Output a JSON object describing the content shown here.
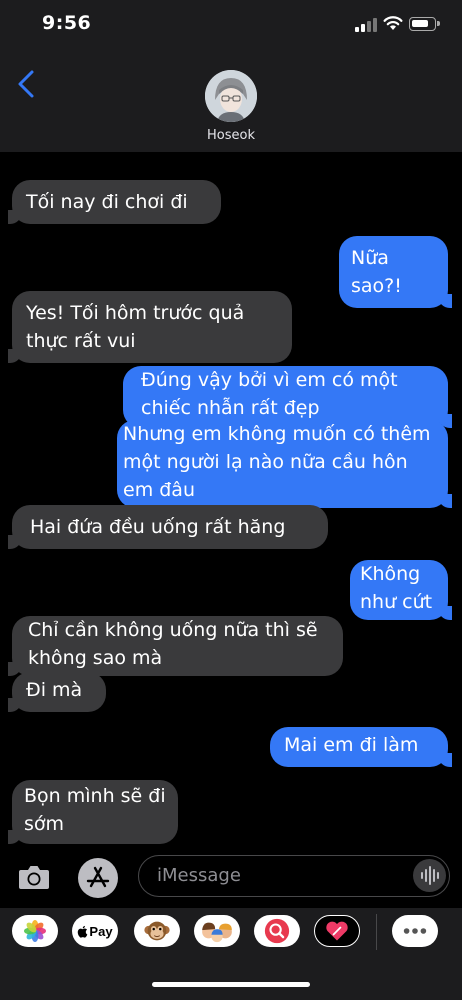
{
  "status": {
    "time": "9:56"
  },
  "header": {
    "contact_name": "Hoseok",
    "back_icon": "chevron-left-icon"
  },
  "messages": [
    {
      "from": "received",
      "text": "Tối nay đi chơi đi"
    },
    {
      "from": "sent",
      "text": "Nữa sao?!"
    },
    {
      "from": "received",
      "text": "Yes! Tối hôm trước quả thực rất vui"
    },
    {
      "from": "sent",
      "text": "Đúng vậy bởi vì em có một chiếc nhẫn rất đẹp"
    },
    {
      "from": "sent",
      "text": "Nhưng em không muốn có thêm một người lạ nào nữa cầu hôn em đâu"
    },
    {
      "from": "received",
      "text": "Hai đứa đều uống rất hăng"
    },
    {
      "from": "sent",
      "text": "Không như cứt"
    },
    {
      "from": "received",
      "text": "Chỉ cần không uống nữa thì sẽ không sao mà"
    },
    {
      "from": "received",
      "text": "Đi mà"
    },
    {
      "from": "sent",
      "text": "Mai em đi làm"
    },
    {
      "from": "received",
      "text": "Bọn mình sẽ đi sớm"
    }
  ],
  "input": {
    "placeholder": "iMessage"
  },
  "app_drawer": [
    {
      "name": "photos-icon"
    },
    {
      "name": "apple-pay-icon",
      "label": "Pay"
    },
    {
      "name": "animoji-icon"
    },
    {
      "name": "memoji-icon"
    },
    {
      "name": "image-search-icon"
    },
    {
      "name": "digital-touch-icon"
    },
    {
      "name": "more-apps-icon"
    }
  ],
  "colors": {
    "sent_bubble": "#3478f6",
    "received_bubble": "#3a3a3c",
    "accent": "#3478f6"
  }
}
